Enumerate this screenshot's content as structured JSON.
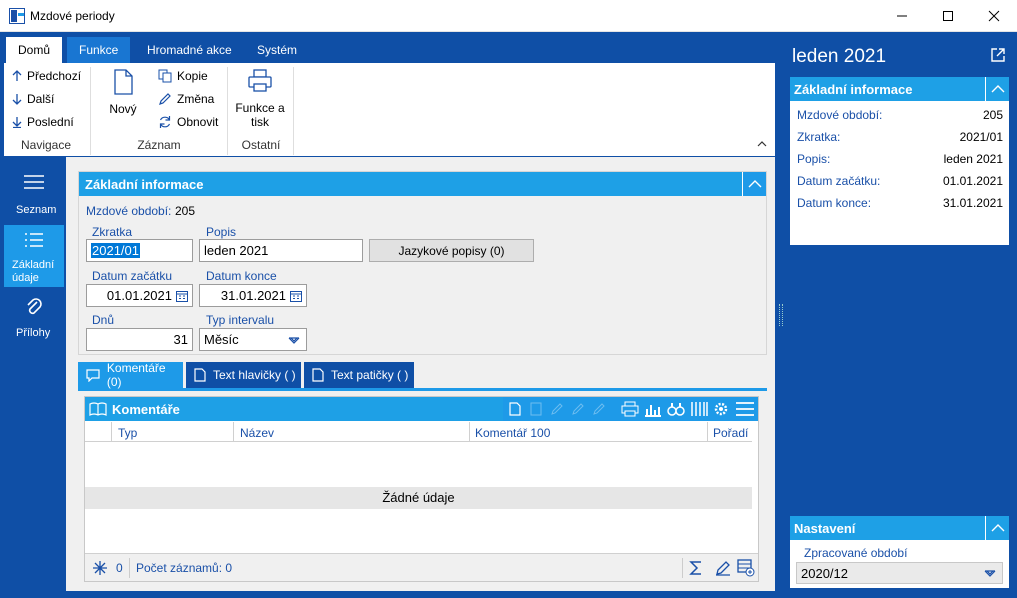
{
  "window": {
    "title": "Mzdové periody"
  },
  "ribbon": {
    "tabs": [
      "Domů",
      "Funkce",
      "Hromadné akce",
      "Systém"
    ],
    "navigation": {
      "prev": "Předchozí",
      "next": "Další",
      "last": "Poslední",
      "group": "Navigace"
    },
    "record": {
      "new": "Nový",
      "copy": "Kopie",
      "change": "Změna",
      "refresh": "Obnovit",
      "group": "Záznam"
    },
    "other": {
      "print_line1": "Funkce a",
      "print_line2": "tisk",
      "group": "Ostatní"
    }
  },
  "leftnav": {
    "items": [
      {
        "label": "Seznam"
      },
      {
        "label": "Základní údaje"
      },
      {
        "label": "Přílohy"
      }
    ]
  },
  "main": {
    "section_title": "Základní informace",
    "period_label": "Mzdové období:",
    "period_value": "205",
    "fields": {
      "zkratka_label": "Zkratka",
      "zkratka_value": "2021/01",
      "popis_label": "Popis",
      "popis_value": "leden 2021",
      "lang_button": "Jazykové popisy (0)",
      "datum_zacatku_label": "Datum začátku",
      "datum_zacatku_value": "01.01.2021",
      "datum_konce_label": "Datum konce",
      "datum_konce_value": "31.01.2021",
      "dnu_label": "Dnů",
      "dnu_value": "31",
      "typ_label": "Typ intervalu",
      "typ_value": "Měsíc"
    },
    "subtabs": [
      "Komentáře (0)",
      "Text hlavičky ( )",
      "Text patičky ( )"
    ],
    "grid": {
      "title": "Komentáře",
      "columns": [
        "Typ",
        "Název",
        "Komentář 100",
        "Pořadí"
      ],
      "empty": "Žádné údaje",
      "footer_count": "0",
      "footer_records": "Počet záznamů: 0"
    }
  },
  "right": {
    "title": "leden 2021",
    "section_title": "Základní informace",
    "rows": [
      {
        "label": "Mzdové období:",
        "value": "205"
      },
      {
        "label": "Zkratka:",
        "value": "2021/01"
      },
      {
        "label": "Popis:",
        "value": "leden 2021"
      },
      {
        "label": "Datum začátku:",
        "value": "01.01.2021"
      },
      {
        "label": "Datum konce:",
        "value": "31.01.2021"
      }
    ],
    "settings_title": "Nastavení",
    "settings_label": "Zpracované období",
    "settings_value": "2020/12"
  },
  "colors": {
    "frame": "#0f4fa6",
    "accent": "#1ea0e6",
    "label_blue": "#1a50a8"
  }
}
